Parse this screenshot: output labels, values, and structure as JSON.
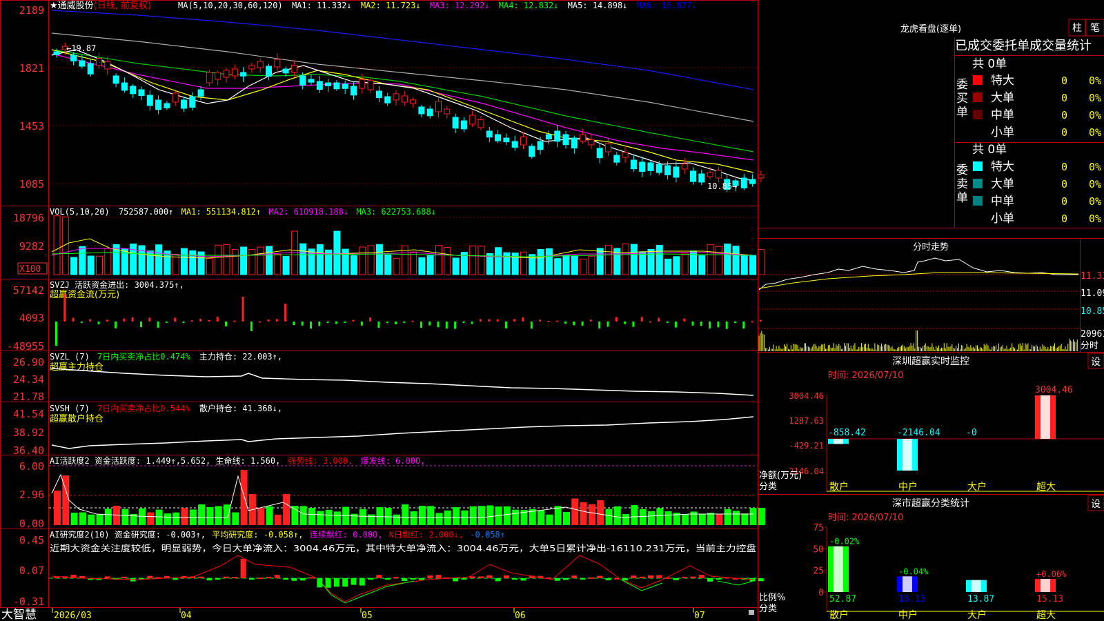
{
  "stock": {
    "name_line": "★通威股份",
    "period": "(日线, 前复权)",
    "ma_label": "MA(5,10,20,30,60,120)",
    "ma_values": [
      "MA1: 11.332↓",
      "MA2: 11.723↓",
      "MA3: 12.292↓",
      "MA4: 12.832↓",
      "MA5: 14.898↓",
      "MA6: 16.877↓"
    ],
    "price_ticks": [
      "2189",
      "1821",
      "1453",
      "1085"
    ],
    "high_label": "19.87",
    "low_label": "10.85"
  },
  "vol": {
    "header": "VOL(5,10,20)",
    "value": "752587.000↑",
    "ma1": "MA1: 551134.812↑",
    "ma2": "MA2: 610918.188↓",
    "ma3": "MA3: 622753.688↓",
    "ticks": [
      "18796",
      "9282"
    ],
    "unit": "X100"
  },
  "svzj": {
    "header": "SVZJ  活跃资金进出: 3004.375↑,",
    "sub": "超赢资金流(万元)",
    "ticks": [
      "57142",
      "4093",
      "-48955"
    ]
  },
  "svzl": {
    "header": "SVZL (7)",
    "ratio": "7日内买卖净占比0.474%",
    "hold": "主力持仓: 22.003↑,",
    "sub": "超赢主力持仓",
    "ticks": [
      "26.90",
      "24.34",
      "21.78"
    ]
  },
  "svsh": {
    "header": "SVSH (7)",
    "ratio": "7日内买卖净占比0.544%",
    "hold": "散户持仓: 41.368↓,",
    "sub": "超赢散户持仓",
    "ticks": [
      "41.54",
      "38.92",
      "36.40"
    ]
  },
  "ai_active": {
    "header": "AI活跃度2 资金活跃度: 1.449↑,5.652, 生命线: 1.560,",
    "strong": "强势线: 3.000,",
    "burst": "爆发线: 6.000,",
    "ticks": [
      "6.00",
      "2.96",
      "0.00"
    ]
  },
  "ai_research": {
    "header": "AI研究度2(10) 资金研究度: -0.003↑,",
    "avg": "平均研究度: -0.058↑,",
    "red": "连续飘红: 0.000,",
    "nred": "N日飘红: 2.000↓,",
    "val": "-0.058↑",
    "comment": "近期大资金关注度较低，明显弱势，今日大单净流入：3004.46万元，其中特大单净流入：3004.46万元，大单5日累计净出-16110.231万元，当前主力控盘",
    "ticks": [
      "0.45",
      "0.07",
      "-0.31"
    ]
  },
  "xaxis": {
    "labels": [
      "2026/03",
      "04",
      "05",
      "06",
      "07"
    ]
  },
  "brand": "大智慧",
  "right": {
    "dragon_title": "龙虎看盘(逐单)",
    "btn_zhu": "柱",
    "btn_bi": "笔",
    "stats_title": "已成交委托单成交量统计",
    "buy_label": "委买单",
    "sell_label": "委卖单",
    "buy_total": "共 0单",
    "sell_total": "共 0单",
    "buy_rows": [
      {
        "name": "特大",
        "count": "0",
        "pct": "0%",
        "color": "#ff0000"
      },
      {
        "name": "大单",
        "count": "0",
        "pct": "0%",
        "color": "#990000"
      },
      {
        "name": "中单",
        "count": "0",
        "pct": "0%",
        "color": "#660000"
      },
      {
        "name": "小单",
        "count": "0",
        "pct": "0%",
        "color": ""
      }
    ],
    "sell_rows": [
      {
        "name": "特大",
        "count": "0",
        "pct": "0%",
        "color": "#00ffff"
      },
      {
        "name": "大单",
        "count": "0",
        "pct": "0%",
        "color": "#008b8b"
      },
      {
        "name": "中单",
        "count": "0",
        "pct": "0%",
        "color": "#008080"
      },
      {
        "name": "小单",
        "count": "0",
        "pct": "0%",
        "color": ""
      }
    ],
    "intraday_title": "分时走势",
    "intraday_ticks": [
      "11.33",
      "11.09",
      "10.85",
      "20961",
      "分时"
    ],
    "sz_title": "深圳超赢实时监控",
    "sz_btn": "设",
    "sz_time": "时间: 2026/07/10",
    "sz_ticks": [
      "3004.46",
      "1287.63",
      "-429.21",
      "-2146.04"
    ],
    "sz_unit": "净额(万元)",
    "sz_cat_label": "分类",
    "cls_title": "深市超赢分类统计",
    "cls_btn": "设",
    "cls_time": "时间: 2026/07/10",
    "cls_ticks": [
      "75",
      "50",
      "25",
      "0"
    ],
    "cls_unit": "比例%",
    "cls_cat_label": "分类"
  },
  "chart_data": [
    {
      "type": "bar",
      "title": "深圳超赢实时监控",
      "ylabel": "净额(万元)",
      "categories": [
        "散户",
        "中户",
        "大户",
        "超大"
      ],
      "values": [
        -858.42,
        -2146.04,
        0,
        3004.46
      ],
      "value_labels": [
        "-858.42",
        "-2146.04",
        "-0",
        "3004.46"
      ],
      "ylim": [
        -2146.04,
        3004.46
      ]
    },
    {
      "type": "bar",
      "title": "深市超赢分类统计",
      "ylabel": "比例%",
      "categories": [
        "散户",
        "中户",
        "大户",
        "超大"
      ],
      "values": [
        52.87,
        18.13,
        13.87,
        15.13
      ],
      "change_labels": [
        "-0.02%",
        "-0.04%",
        "",
        "+0.06%"
      ],
      "ylim": [
        0,
        75
      ]
    }
  ]
}
